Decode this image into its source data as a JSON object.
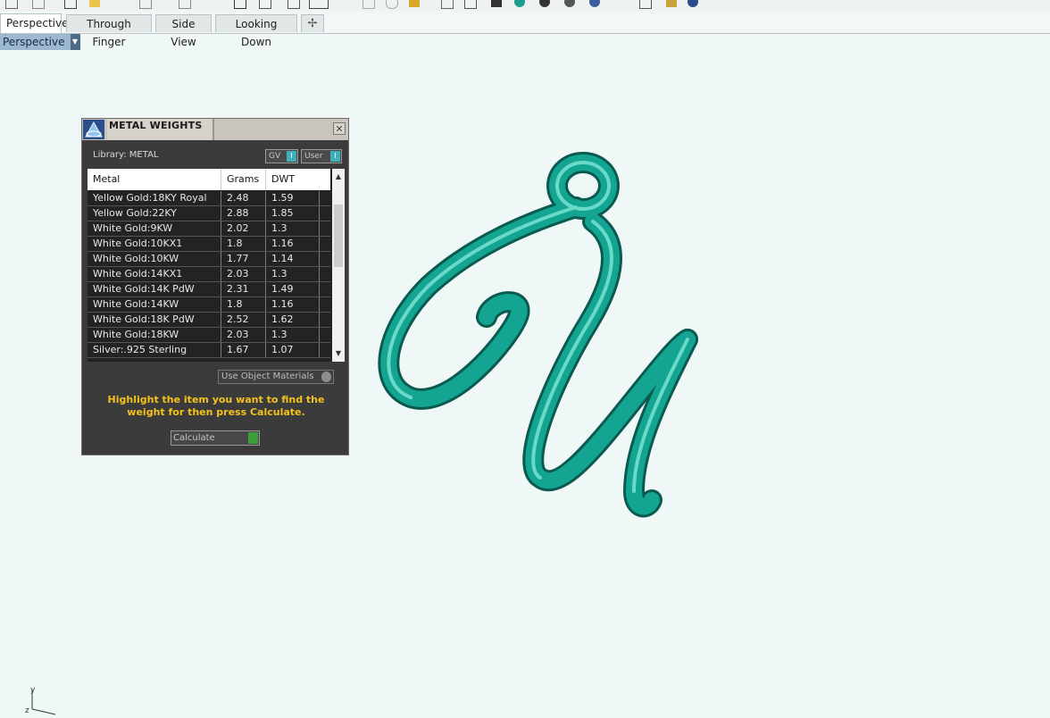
{
  "tabs": [
    "Perspective",
    "Through Finger",
    "Side View",
    "Looking Down"
  ],
  "add_tab_glyph": "✢",
  "viewport_label": "Perspective",
  "panel": {
    "title": "METAL WEIGHTS",
    "close_glyph": "✕",
    "library": "Library: METAL",
    "gv_label": "GV",
    "user_label": "User",
    "columns": [
      "Metal",
      "Grams",
      "DWT"
    ],
    "rows": [
      [
        "Yellow Gold:18KY Royal",
        "2.48",
        "1.59"
      ],
      [
        "Yellow Gold:22KY",
        "2.88",
        "1.85"
      ],
      [
        "White Gold:9KW",
        "2.02",
        "1.3"
      ],
      [
        "White Gold:10KX1",
        "1.8",
        "1.16"
      ],
      [
        "White Gold:10KW",
        "1.77",
        "1.14"
      ],
      [
        "White Gold:14KX1",
        "2.03",
        "1.3"
      ],
      [
        "White Gold:14K PdW",
        "2.31",
        "1.49"
      ],
      [
        "White Gold:14KW",
        "1.8",
        "1.16"
      ],
      [
        "White Gold:18K PdW",
        "2.52",
        "1.62"
      ],
      [
        "White Gold:18KW",
        "2.03",
        "1.3"
      ],
      [
        "Silver:.925 Sterling",
        "1.67",
        "1.07"
      ]
    ],
    "use_object_materials": "Use Object Materials",
    "hint": "Highlight the item you want to find the weight for then press Calculate.",
    "calculate": "Calculate"
  },
  "axis_labels": {
    "y": "y",
    "z": "z"
  },
  "colors": {
    "model": "#13a08f",
    "hint": "#f4c21d",
    "viewport_bg": "#eff7f7"
  }
}
